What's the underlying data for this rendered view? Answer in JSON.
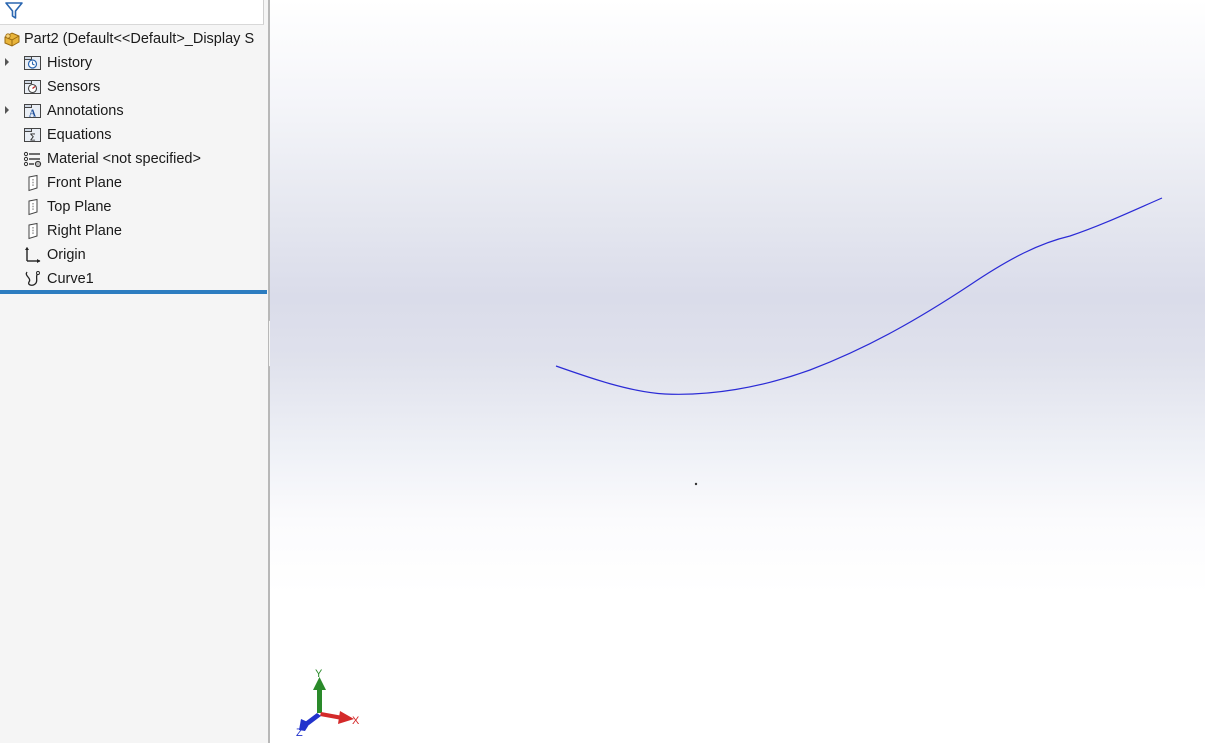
{
  "tree": {
    "root": {
      "label": "Part2  (Default<<Default>_Display S",
      "icon": "part-icon"
    },
    "items": [
      {
        "label": "History",
        "icon": "history-folder-icon",
        "expandable": true
      },
      {
        "label": "Sensors",
        "icon": "sensors-folder-icon",
        "expandable": false
      },
      {
        "label": "Annotations",
        "icon": "annotations-folder-icon",
        "expandable": true
      },
      {
        "label": "Equations",
        "icon": "equations-folder-icon",
        "expandable": false
      },
      {
        "label": "Material <not specified>",
        "icon": "material-icon",
        "expandable": false
      },
      {
        "label": "Front Plane",
        "icon": "plane-icon",
        "expandable": false
      },
      {
        "label": "Top Plane",
        "icon": "plane-icon",
        "expandable": false
      },
      {
        "label": "Right Plane",
        "icon": "plane-icon",
        "expandable": false
      },
      {
        "label": "Origin",
        "icon": "origin-icon",
        "expandable": false
      },
      {
        "label": "Curve1",
        "icon": "curve-icon",
        "expandable": false
      }
    ]
  },
  "viewport": {
    "curve_color": "#2b2bd6",
    "triad": {
      "x_label": "X",
      "y_label": "Y",
      "z_label": "Z",
      "x_color": "#d42a2a",
      "y_color": "#2a8a2a",
      "z_color": "#2233cc"
    }
  },
  "colors": {
    "rollback_bar": "#2d7dc0",
    "panel_bg": "#f5f5f5"
  }
}
